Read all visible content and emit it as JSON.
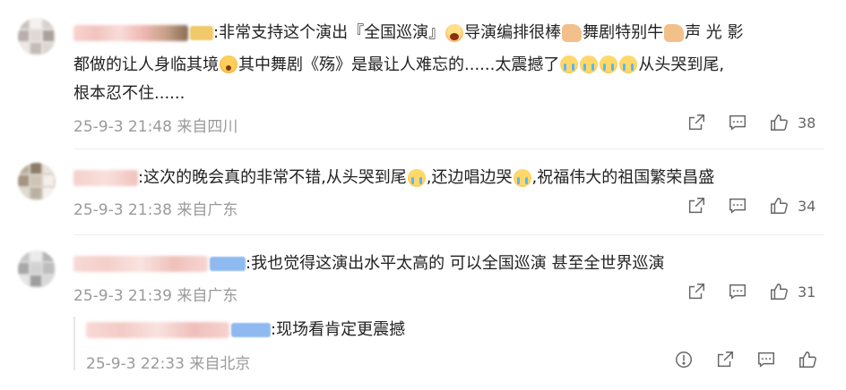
{
  "comments": [
    {
      "text1": ":非常支持这个演出『全国巡演』",
      "text1b": "导演编排很棒",
      "text1c": "舞剧特别牛",
      "text1d": "声 光 影",
      "text2a": "都做的让人身临其境",
      "text2b": "其中舞剧《殇》是最让人难忘的......太震撼了",
      "text2c": "从头哭到尾,",
      "text3": "根本忍不住......",
      "time": "25-9-3 21:48 来自四川",
      "likes": "38"
    },
    {
      "text1": ":这次的晚会真的非常不错,从头哭到尾",
      "text1b": ",还边唱边哭",
      "text1c": ",祝福伟大的祖国繁荣昌盛",
      "time": "25-9-3 21:38 来自广东",
      "likes": "34"
    },
    {
      "text1": ":我也觉得这演出水平太高的 可以全国巡演 甚至全世界巡演",
      "time": "25-9-3 21:39 来自广东",
      "likes": "31"
    }
  ],
  "reply": {
    "text": ":现场看肯定更震撼",
    "time": "25-9-3 22:33 来自北京"
  },
  "icons": {
    "share": "share-icon",
    "comment": "comment-icon",
    "like": "like-icon",
    "report": "report-icon",
    "emoji_cry": "crying-face-emoji",
    "emoji_thumb": "thumbs-up-emoji",
    "emoji_wow": "astonished-face-emoji",
    "emoji_scream": "screaming-face-emoji"
  },
  "colors": {
    "text": "#222222",
    "meta": "#9a9a9a",
    "icon": "#666666",
    "badge": "#8fbaf0"
  }
}
